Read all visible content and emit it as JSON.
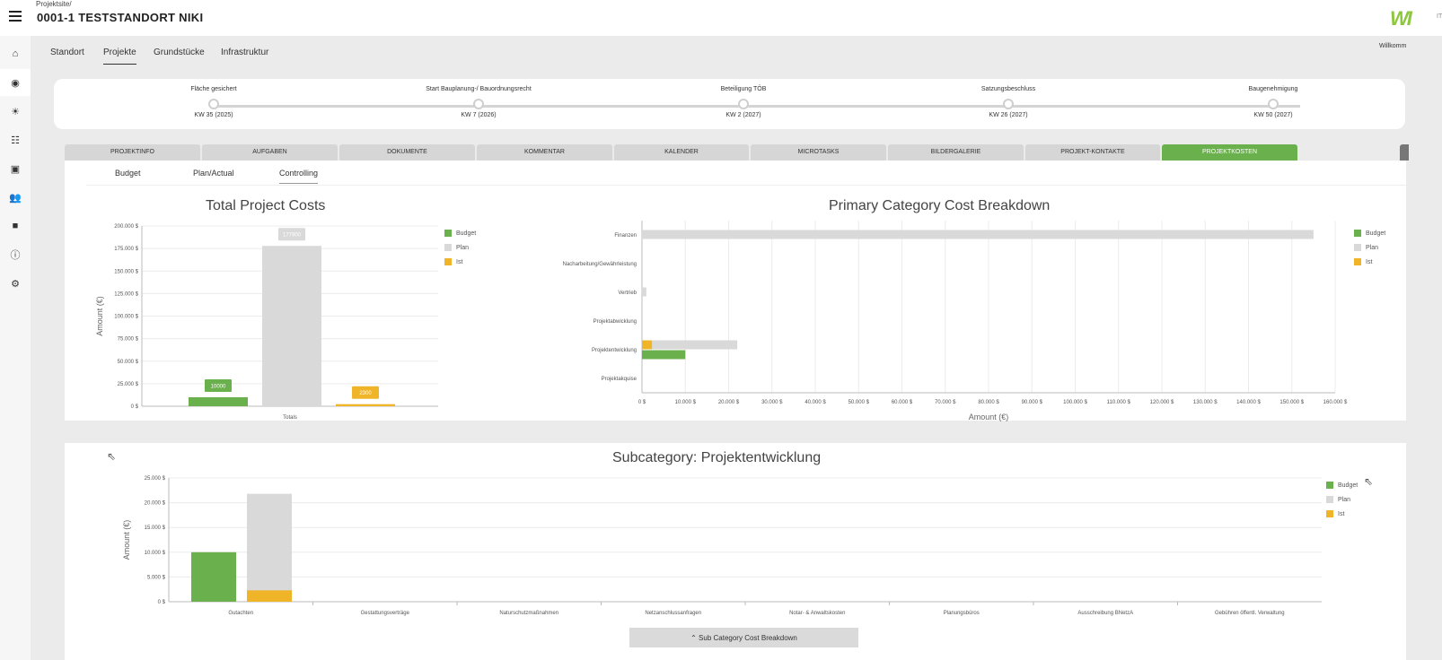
{
  "header": {
    "breadcrumb_small": "Projektsite/",
    "title": "0001-1 TESTSTANDORT NIKI",
    "logo": "WI",
    "logo_suffix": "IT",
    "welcome": "Willkomm"
  },
  "sidebar": {
    "items": [
      {
        "icon": "home-icon",
        "glyph": "⌂"
      },
      {
        "icon": "location-pin-icon",
        "glyph": "◉",
        "active": true
      },
      {
        "icon": "weather-icon",
        "glyph": "☀"
      },
      {
        "icon": "list-icon",
        "glyph": "☷"
      },
      {
        "icon": "chart-icon",
        "glyph": "▣"
      },
      {
        "icon": "users-icon",
        "glyph": "👥"
      },
      {
        "icon": "folder-icon",
        "glyph": "■"
      },
      {
        "icon": "info-icon",
        "glyph": "ⓘ"
      },
      {
        "icon": "gear-icon",
        "glyph": "⚙"
      }
    ]
  },
  "nav": {
    "items": [
      "Standort",
      "Projekte",
      "Grundstücke",
      "Infrastruktur"
    ],
    "active": "Projekte"
  },
  "milestones": [
    {
      "label": "Fläche gesichert",
      "date": "KW 35 (2025)"
    },
    {
      "label": "Start Bauplanung-/ Bauordnungsrecht",
      "date": "KW 7 (2026)"
    },
    {
      "label": "Beteiligung TÖB",
      "date": "KW 2 (2027)"
    },
    {
      "label": "Satzungsbeschluss",
      "date": "KW 26 (2027)"
    },
    {
      "label": "Baugenehmigung",
      "date": "KW 50 (2027)"
    }
  ],
  "tabs": [
    "PROJEKTINFO",
    "AUFGABEN",
    "DOKUMENTE",
    "KOMMENTAR",
    "KALENDER",
    "MICROTASKS",
    "BILDERGALERIE",
    "PROJEKT-KONTAKTE",
    "PROJEKTKOSTEN"
  ],
  "active_tab": "PROJEKTKOSTEN",
  "subtabs": [
    "Budget",
    "Plan/Actual",
    "Controlling"
  ],
  "active_subtab": "Controlling",
  "colors": {
    "budget": "#6ab04c",
    "plan": "#d9d9d9",
    "ist": "#f0b429",
    "active_tab": "#6ab04c"
  },
  "legend": [
    "Budget",
    "Plan",
    "Ist"
  ],
  "bottom_button": {
    "arrow": "⌃",
    "label": "Sub Category Cost Breakdown"
  },
  "chart_data": [
    {
      "type": "bar",
      "title": "Total Project Costs",
      "categories": [
        "Totals"
      ],
      "series": [
        {
          "name": "Budget",
          "values": [
            10000
          ],
          "label": "10000"
        },
        {
          "name": "Plan",
          "values": [
            177900
          ],
          "label": "177900"
        },
        {
          "name": "Ist",
          "values": [
            2300
          ],
          "label": "2300"
        }
      ],
      "ylabel": "Amount (€)",
      "ylim": [
        0,
        200000
      ],
      "yticks": [
        "0 $",
        "25.000 $",
        "50.000 $",
        "75.000 $",
        "100.000 $",
        "125.000 $",
        "150.000 $",
        "175.000 $",
        "200.000 $"
      ],
      "legend_position": "right"
    },
    {
      "type": "bar",
      "orientation": "horizontal",
      "title": "Primary Category Cost Breakdown",
      "categories": [
        "Finanzen",
        "Nacharbeitung/Gewährleistung",
        "Vertrieb",
        "Projektabwicklung",
        "Projektentwicklung",
        "Projektakquise"
      ],
      "series": [
        {
          "name": "Budget",
          "values": [
            0,
            0,
            0,
            0,
            10000,
            0
          ]
        },
        {
          "name": "Plan",
          "values": [
            155000,
            0,
            1000,
            0,
            22000,
            0
          ]
        },
        {
          "name": "Ist",
          "values": [
            0,
            0,
            0,
            0,
            2300,
            0
          ]
        }
      ],
      "xlabel": "Amount (€)",
      "xlim": [
        0,
        160000
      ],
      "xticks": [
        "0 $",
        "10.000 $",
        "20.000 $",
        "30.000 $",
        "40.000 $",
        "50.000 $",
        "60.000 $",
        "70.000 $",
        "80.000 $",
        "90.000 $",
        "100.000 $",
        "110.000 $",
        "120.000 $",
        "130.000 $",
        "140.000 $",
        "150.000 $",
        "160.000 $"
      ],
      "legend_position": "right"
    },
    {
      "type": "bar",
      "title": "Subcategory: Projektentwicklung",
      "categories": [
        "Gutachten",
        "Gestattungsverträge",
        "Naturschutzmaßnahmen",
        "Netzanschlussanfragen",
        "Notar- & Anwaltskosten",
        "Planungsbüros",
        "Ausschreibung BNetzA",
        "Gebühren öffentl. Verwaltung"
      ],
      "series": [
        {
          "name": "Budget",
          "values": [
            10000,
            0,
            0,
            0,
            0,
            0,
            0,
            0
          ]
        },
        {
          "name": "Plan",
          "values": [
            21800,
            0,
            0,
            0,
            0,
            0,
            0,
            0
          ]
        },
        {
          "name": "Ist",
          "values": [
            2300,
            0,
            0,
            0,
            0,
            0,
            0,
            0
          ]
        }
      ],
      "ylabel": "Amount (€)",
      "ylim": [
        0,
        25000
      ],
      "yticks": [
        "0 $",
        "5.000 $",
        "10.000 $",
        "15.000 $",
        "20.000 $",
        "25.000 $"
      ],
      "legend_position": "right"
    }
  ]
}
